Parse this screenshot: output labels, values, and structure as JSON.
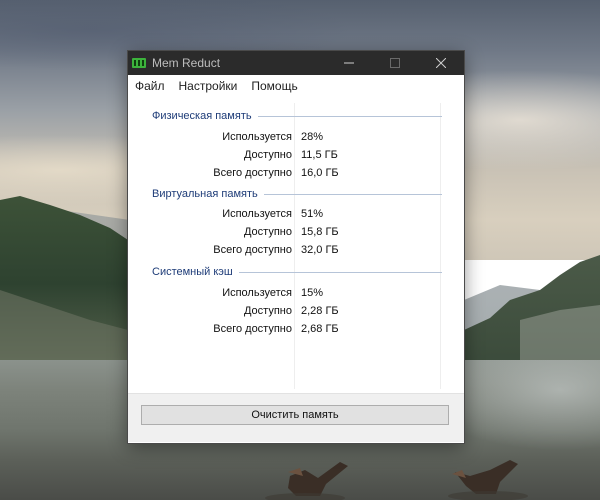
{
  "window": {
    "title": "Mem Reduct",
    "controls": [
      "minimize-icon",
      "maximize-icon",
      "close-icon"
    ]
  },
  "menu": {
    "items": [
      "Файл",
      "Настройки",
      "Помощь"
    ]
  },
  "groups": [
    {
      "title": "Физическая память",
      "rows": [
        {
          "label": "Используется",
          "value": "28%"
        },
        {
          "label": "Доступно",
          "value": "11,5 ГБ"
        },
        {
          "label": "Всего доступно",
          "value": "16,0 ГБ"
        }
      ]
    },
    {
      "title": "Виртуальная память",
      "rows": [
        {
          "label": "Используется",
          "value": "51%"
        },
        {
          "label": "Доступно",
          "value": "15,8 ГБ"
        },
        {
          "label": "Всего доступно",
          "value": "32,0 ГБ"
        }
      ]
    },
    {
      "title": "Системный кэш",
      "rows": [
        {
          "label": "Используется",
          "value": "15%"
        },
        {
          "label": "Доступно",
          "value": "2,28 ГБ"
        },
        {
          "label": "Всего доступно",
          "value": "2,68 ГБ"
        }
      ]
    }
  ],
  "footer": {
    "clean_button": "Очистить память"
  },
  "colors": {
    "titlebar": "#2b2b2b",
    "group_title": "#1e3c78",
    "app_icon": "#3cb43c"
  }
}
